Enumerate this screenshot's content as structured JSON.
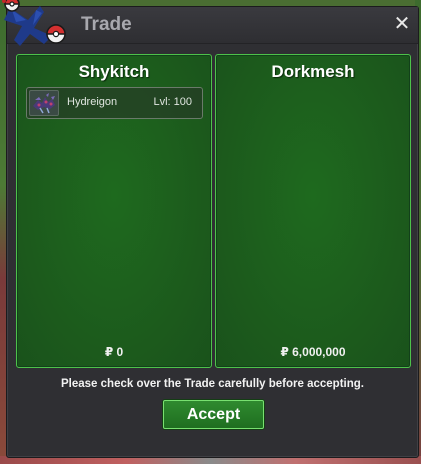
{
  "window": {
    "title": "Trade",
    "close_symbol": "✕"
  },
  "trade": {
    "left": {
      "player": "Shykitch",
      "items": [
        {
          "name": "Hydreigon",
          "level": "Lvl: 100",
          "icon": "hydreigon-sprite"
        }
      ],
      "money": "₽ 0"
    },
    "right": {
      "player": "Dorkmesh",
      "items": [],
      "money": "₽ 6,000,000"
    }
  },
  "notice": "Please check over the Trade carefully before accepting.",
  "accept_label": "Accept",
  "colors": {
    "panel_green": "#1d5f1d",
    "panel_border": "#4dc24a",
    "window_bg": "#2f2f33",
    "accept_green": "#2a7e2a"
  }
}
